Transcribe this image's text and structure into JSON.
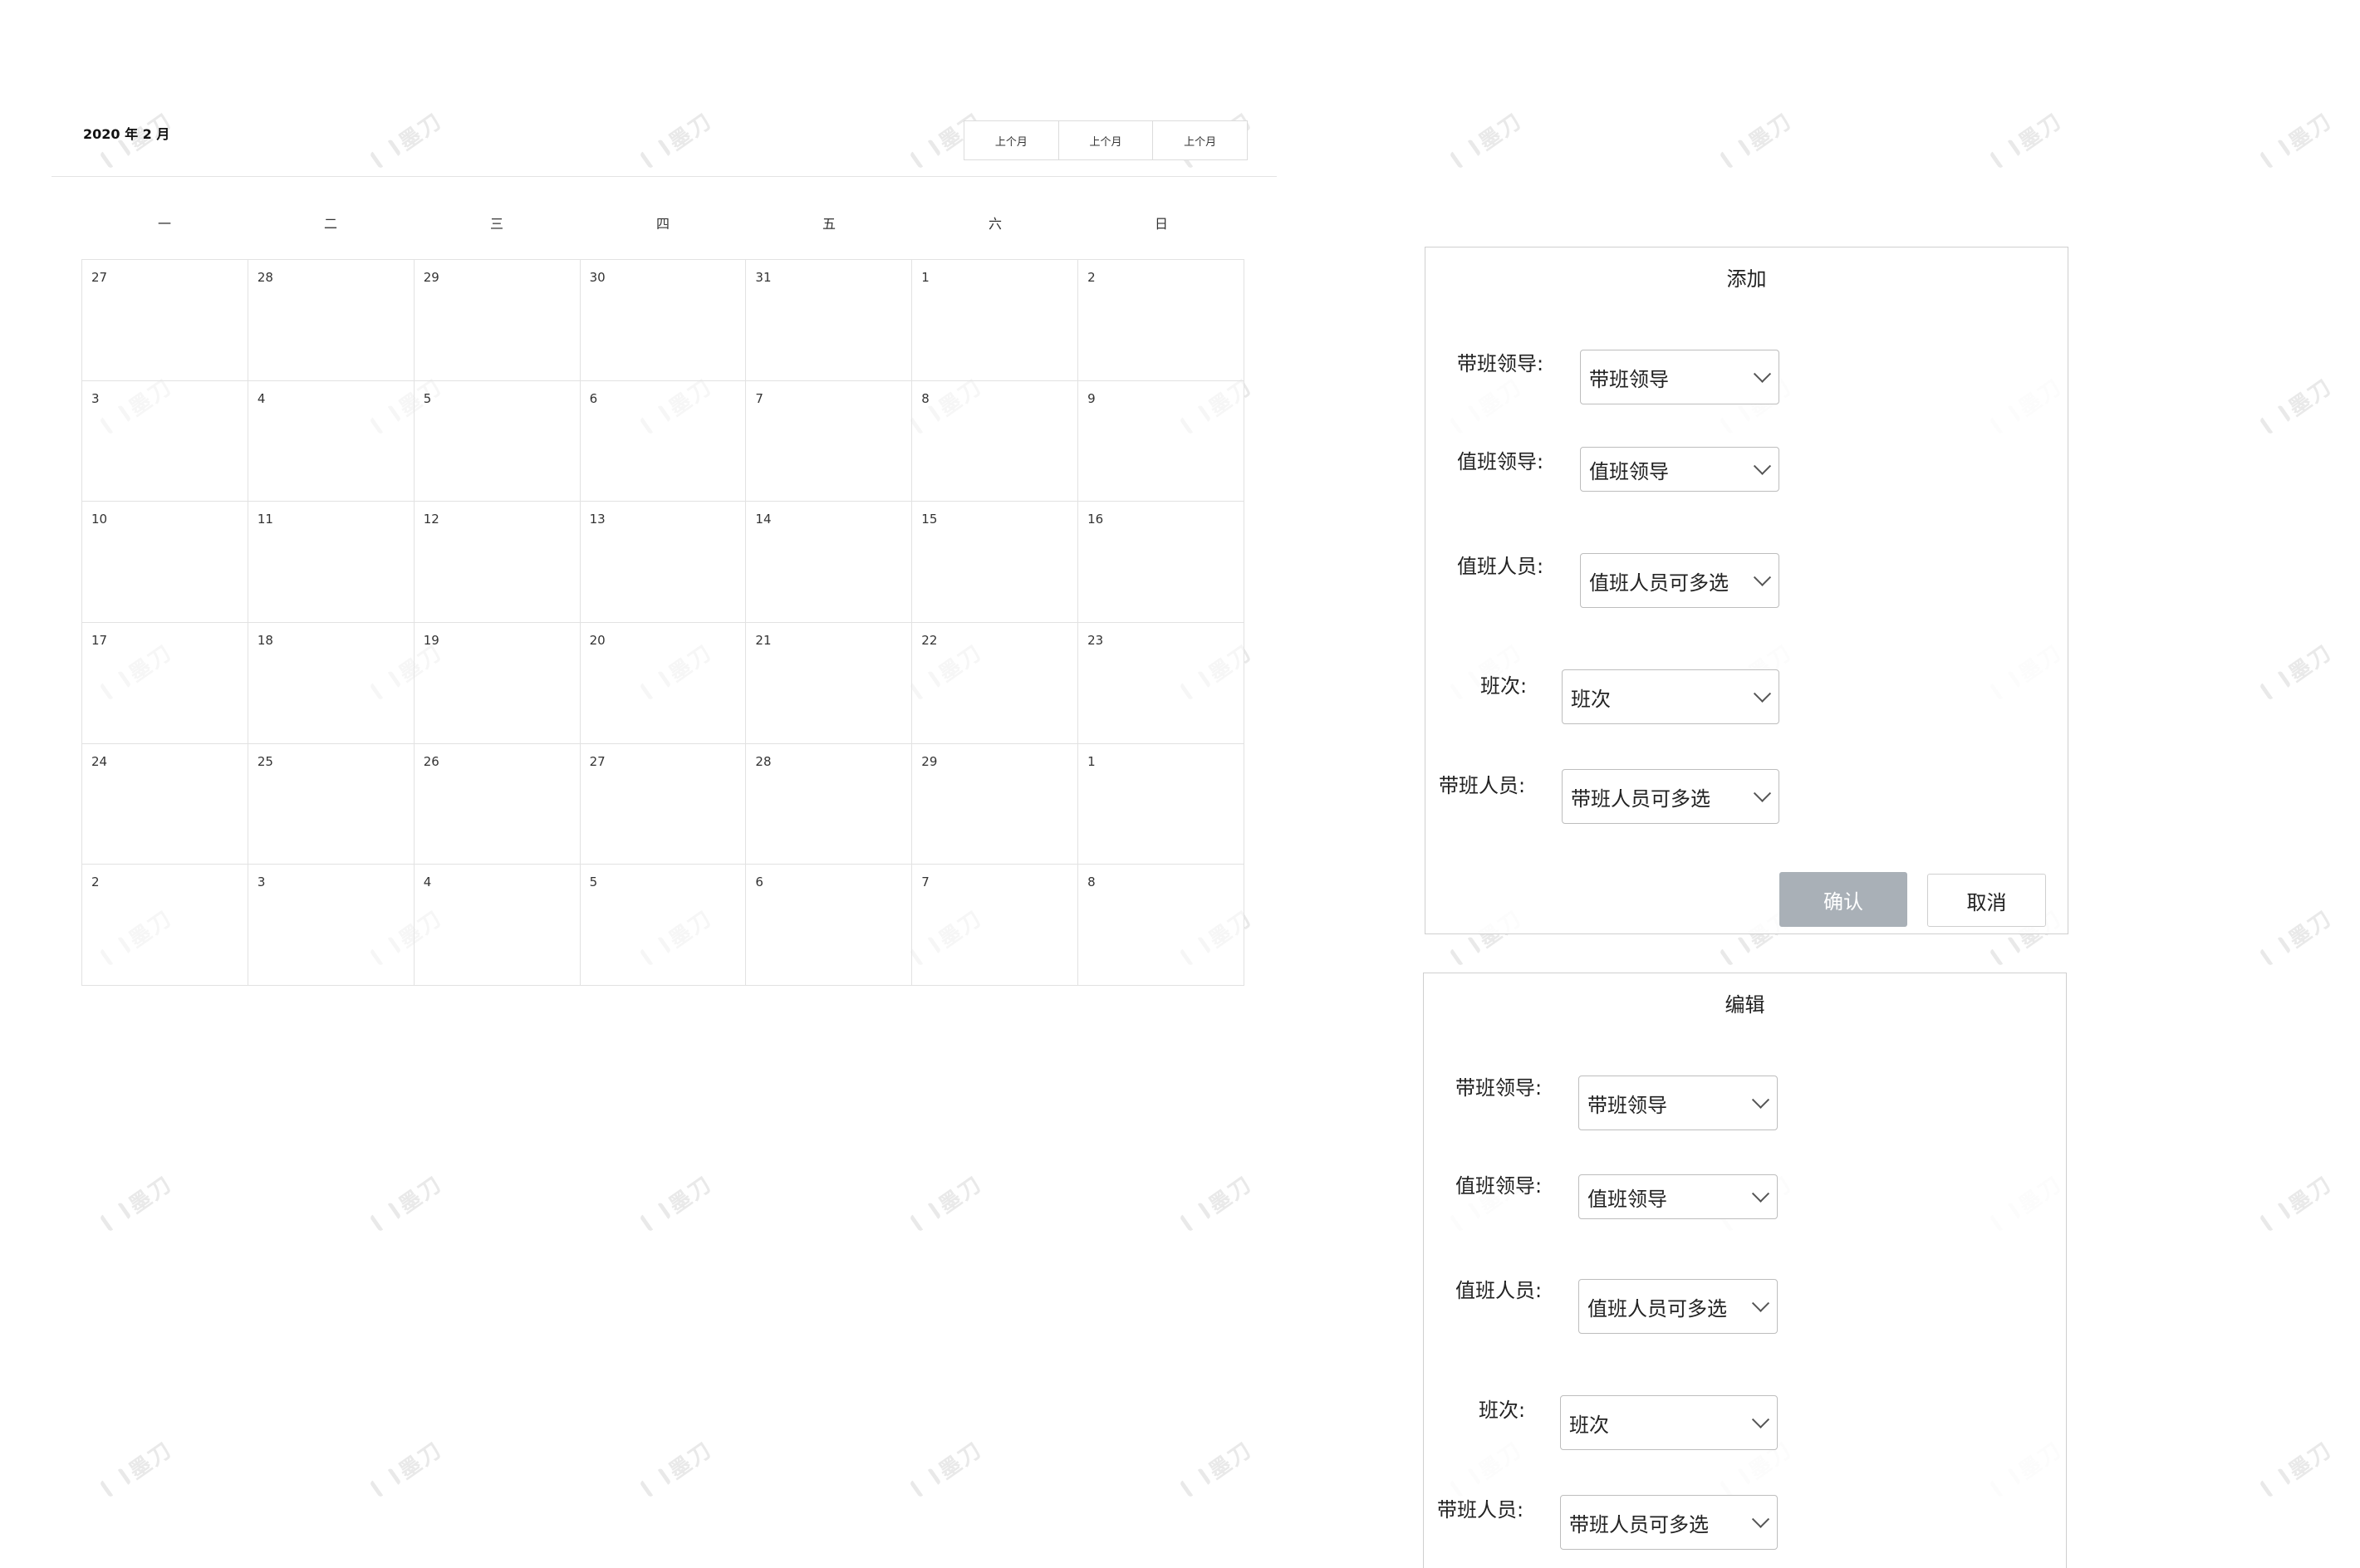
{
  "calendar": {
    "title": "2020 年 2 月",
    "nav_buttons": [
      "上个月",
      "上个月",
      "上个月"
    ],
    "weekdays": [
      "一",
      "二",
      "三",
      "四",
      "五",
      "六",
      "日"
    ],
    "days": [
      [
        "27",
        "28",
        "29",
        "30",
        "31",
        "1",
        "2"
      ],
      [
        "3",
        "4",
        "5",
        "6",
        "7",
        "8",
        "9"
      ],
      [
        "10",
        "11",
        "12",
        "13",
        "14",
        "15",
        "16"
      ],
      [
        "17",
        "18",
        "19",
        "20",
        "21",
        "22",
        "23"
      ],
      [
        "24",
        "25",
        "26",
        "27",
        "28",
        "29",
        "1"
      ],
      [
        "2",
        "3",
        "4",
        "5",
        "6",
        "7",
        "8"
      ]
    ]
  },
  "add_dialog": {
    "title": "添加",
    "fields": [
      {
        "label": "带班领导:",
        "value": "带班领导"
      },
      {
        "label": "值班领导:",
        "value": "值班领导"
      },
      {
        "label": "值班人员:",
        "value": "值班人员可多选"
      },
      {
        "label": "班次:",
        "value": "班次"
      },
      {
        "label": "带班人员:",
        "value": "带班人员可多选"
      }
    ],
    "confirm_label": "确认",
    "cancel_label": "取消"
  },
  "edit_dialog": {
    "title": "编辑",
    "fields": [
      {
        "label": "带班领导:",
        "value": "带班领导"
      },
      {
        "label": "值班领导:",
        "value": "值班领导"
      },
      {
        "label": "值班人员:",
        "value": "值班人员可多选"
      },
      {
        "label": "班次:",
        "value": "班次"
      },
      {
        "label": "带班人员:",
        "value": "带班人员可多选"
      }
    ]
  }
}
